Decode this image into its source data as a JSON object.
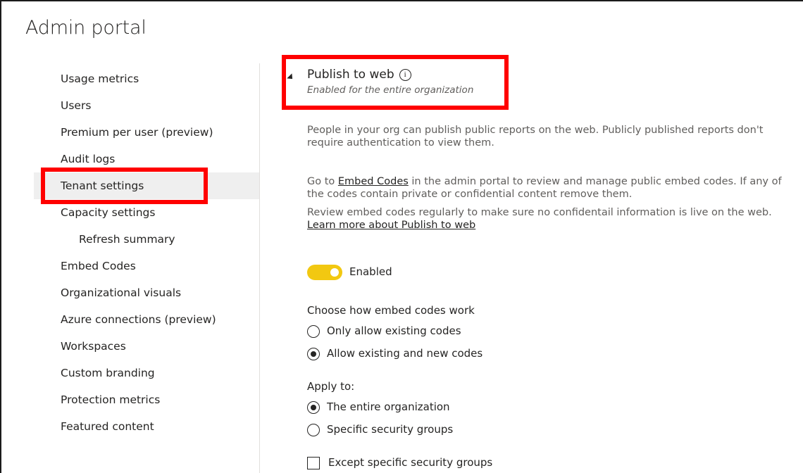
{
  "page": {
    "title": "Admin portal"
  },
  "sidebar": {
    "items": [
      {
        "label": "Usage metrics"
      },
      {
        "label": "Users"
      },
      {
        "label": "Premium per user (preview)"
      },
      {
        "label": "Audit logs"
      },
      {
        "label": "Tenant settings",
        "active": true
      },
      {
        "label": "Capacity settings"
      },
      {
        "label": "Refresh summary",
        "sub": true
      },
      {
        "label": "Embed Codes"
      },
      {
        "label": "Organizational visuals"
      },
      {
        "label": "Azure connections (preview)"
      },
      {
        "label": "Workspaces"
      },
      {
        "label": "Custom branding"
      },
      {
        "label": "Protection metrics"
      },
      {
        "label": "Featured content"
      }
    ]
  },
  "setting": {
    "title": "Publish to web",
    "info_icon": "info-icon",
    "subtitle": "Enabled for the entire organization",
    "para1": "People in your org can publish public reports on the web. Publicly published reports don't require authentication to view them.",
    "para2_prefix": "Go to ",
    "para2_link": "Embed Codes",
    "para2_suffix": " in the admin portal to review and manage public embed codes. If any of the codes contain private or confidential content remove them.",
    "para3_prefix": "Review embed codes regularly to make sure no confidentail information is live on the web. ",
    "para3_link": "Learn more about Publish to web",
    "toggle_label": "Enabled",
    "toggle_on": true,
    "embed_group_label": "Choose how embed codes work",
    "embed_options": [
      {
        "label": "Only allow existing codes",
        "checked": false
      },
      {
        "label": "Allow existing and new codes",
        "checked": true
      }
    ],
    "apply_label": "Apply to:",
    "apply_options": [
      {
        "label": "The entire organization",
        "checked": true
      },
      {
        "label": "Specific security groups",
        "checked": false
      }
    ],
    "except_label": "Except specific security groups",
    "except_checked": false
  },
  "colors": {
    "toggle_on": "#f2c811",
    "highlight": "#ff0000",
    "active_bg": "#efefef"
  }
}
